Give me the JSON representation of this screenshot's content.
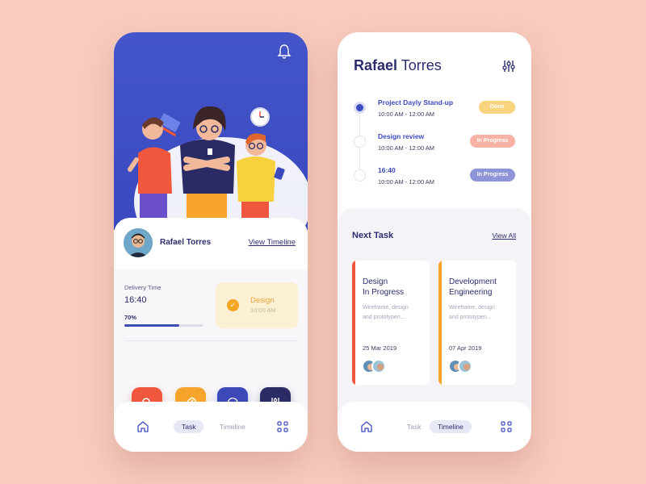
{
  "left_phone": {
    "profile": {
      "name": "Rafael Torres",
      "link": "View Timeline"
    },
    "delivery": {
      "label": "Delivery Time",
      "time": "16:40",
      "progress_label": "70%",
      "progress": 0.7
    },
    "current_task": {
      "title": "Design",
      "time": "10:00 AM"
    },
    "actions": [
      {
        "icon": "search-icon",
        "color": "#f0573c"
      },
      {
        "icon": "paperclip-icon",
        "color": "#f6a42c"
      },
      {
        "icon": "chat-icon",
        "color": "#3c49b6"
      },
      {
        "icon": "sliders-icon",
        "color": "#2a2b64"
      }
    ],
    "nav": {
      "active": "Task",
      "inactive": "Timeline"
    }
  },
  "right_phone": {
    "header": {
      "first": "Rafael",
      "last": "Torres"
    },
    "timeline": [
      {
        "title": "Project Dayly Stand-up",
        "time": "10:00 AM - 12:00 AM",
        "status": "Done",
        "status_color": "#f9d47e"
      },
      {
        "title": "Design review",
        "time": "10:00 AM - 12:00 AM",
        "status": "In Progress",
        "status_color": "#f7b2a4"
      },
      {
        "title": "16:40",
        "time": "10:00 AM - 12:00 AM",
        "status": "In Progress",
        "status_color": "#8e94d8"
      }
    ],
    "next": {
      "title": "Next Task",
      "link": "View All",
      "cards": [
        {
          "title_line1": "Design",
          "title_line2": "In Progress",
          "desc_line1": "Wireframe, design",
          "desc_line2": "and prototypen...",
          "date": "25 Mar 2019",
          "accent": "#f0573c"
        },
        {
          "title_line1": "Development",
          "title_line2": "Engineering",
          "desc_line1": "Wireframe, design",
          "desc_line2": "and prototypen...",
          "date": "07 Apr 2019",
          "accent": "#f6a42c"
        }
      ]
    },
    "nav": {
      "inactive": "Task",
      "active": "Timeline"
    }
  },
  "colors": {
    "background": "#f7cbbd",
    "primary": "#3c4abd",
    "dark": "#2b2d6e"
  }
}
